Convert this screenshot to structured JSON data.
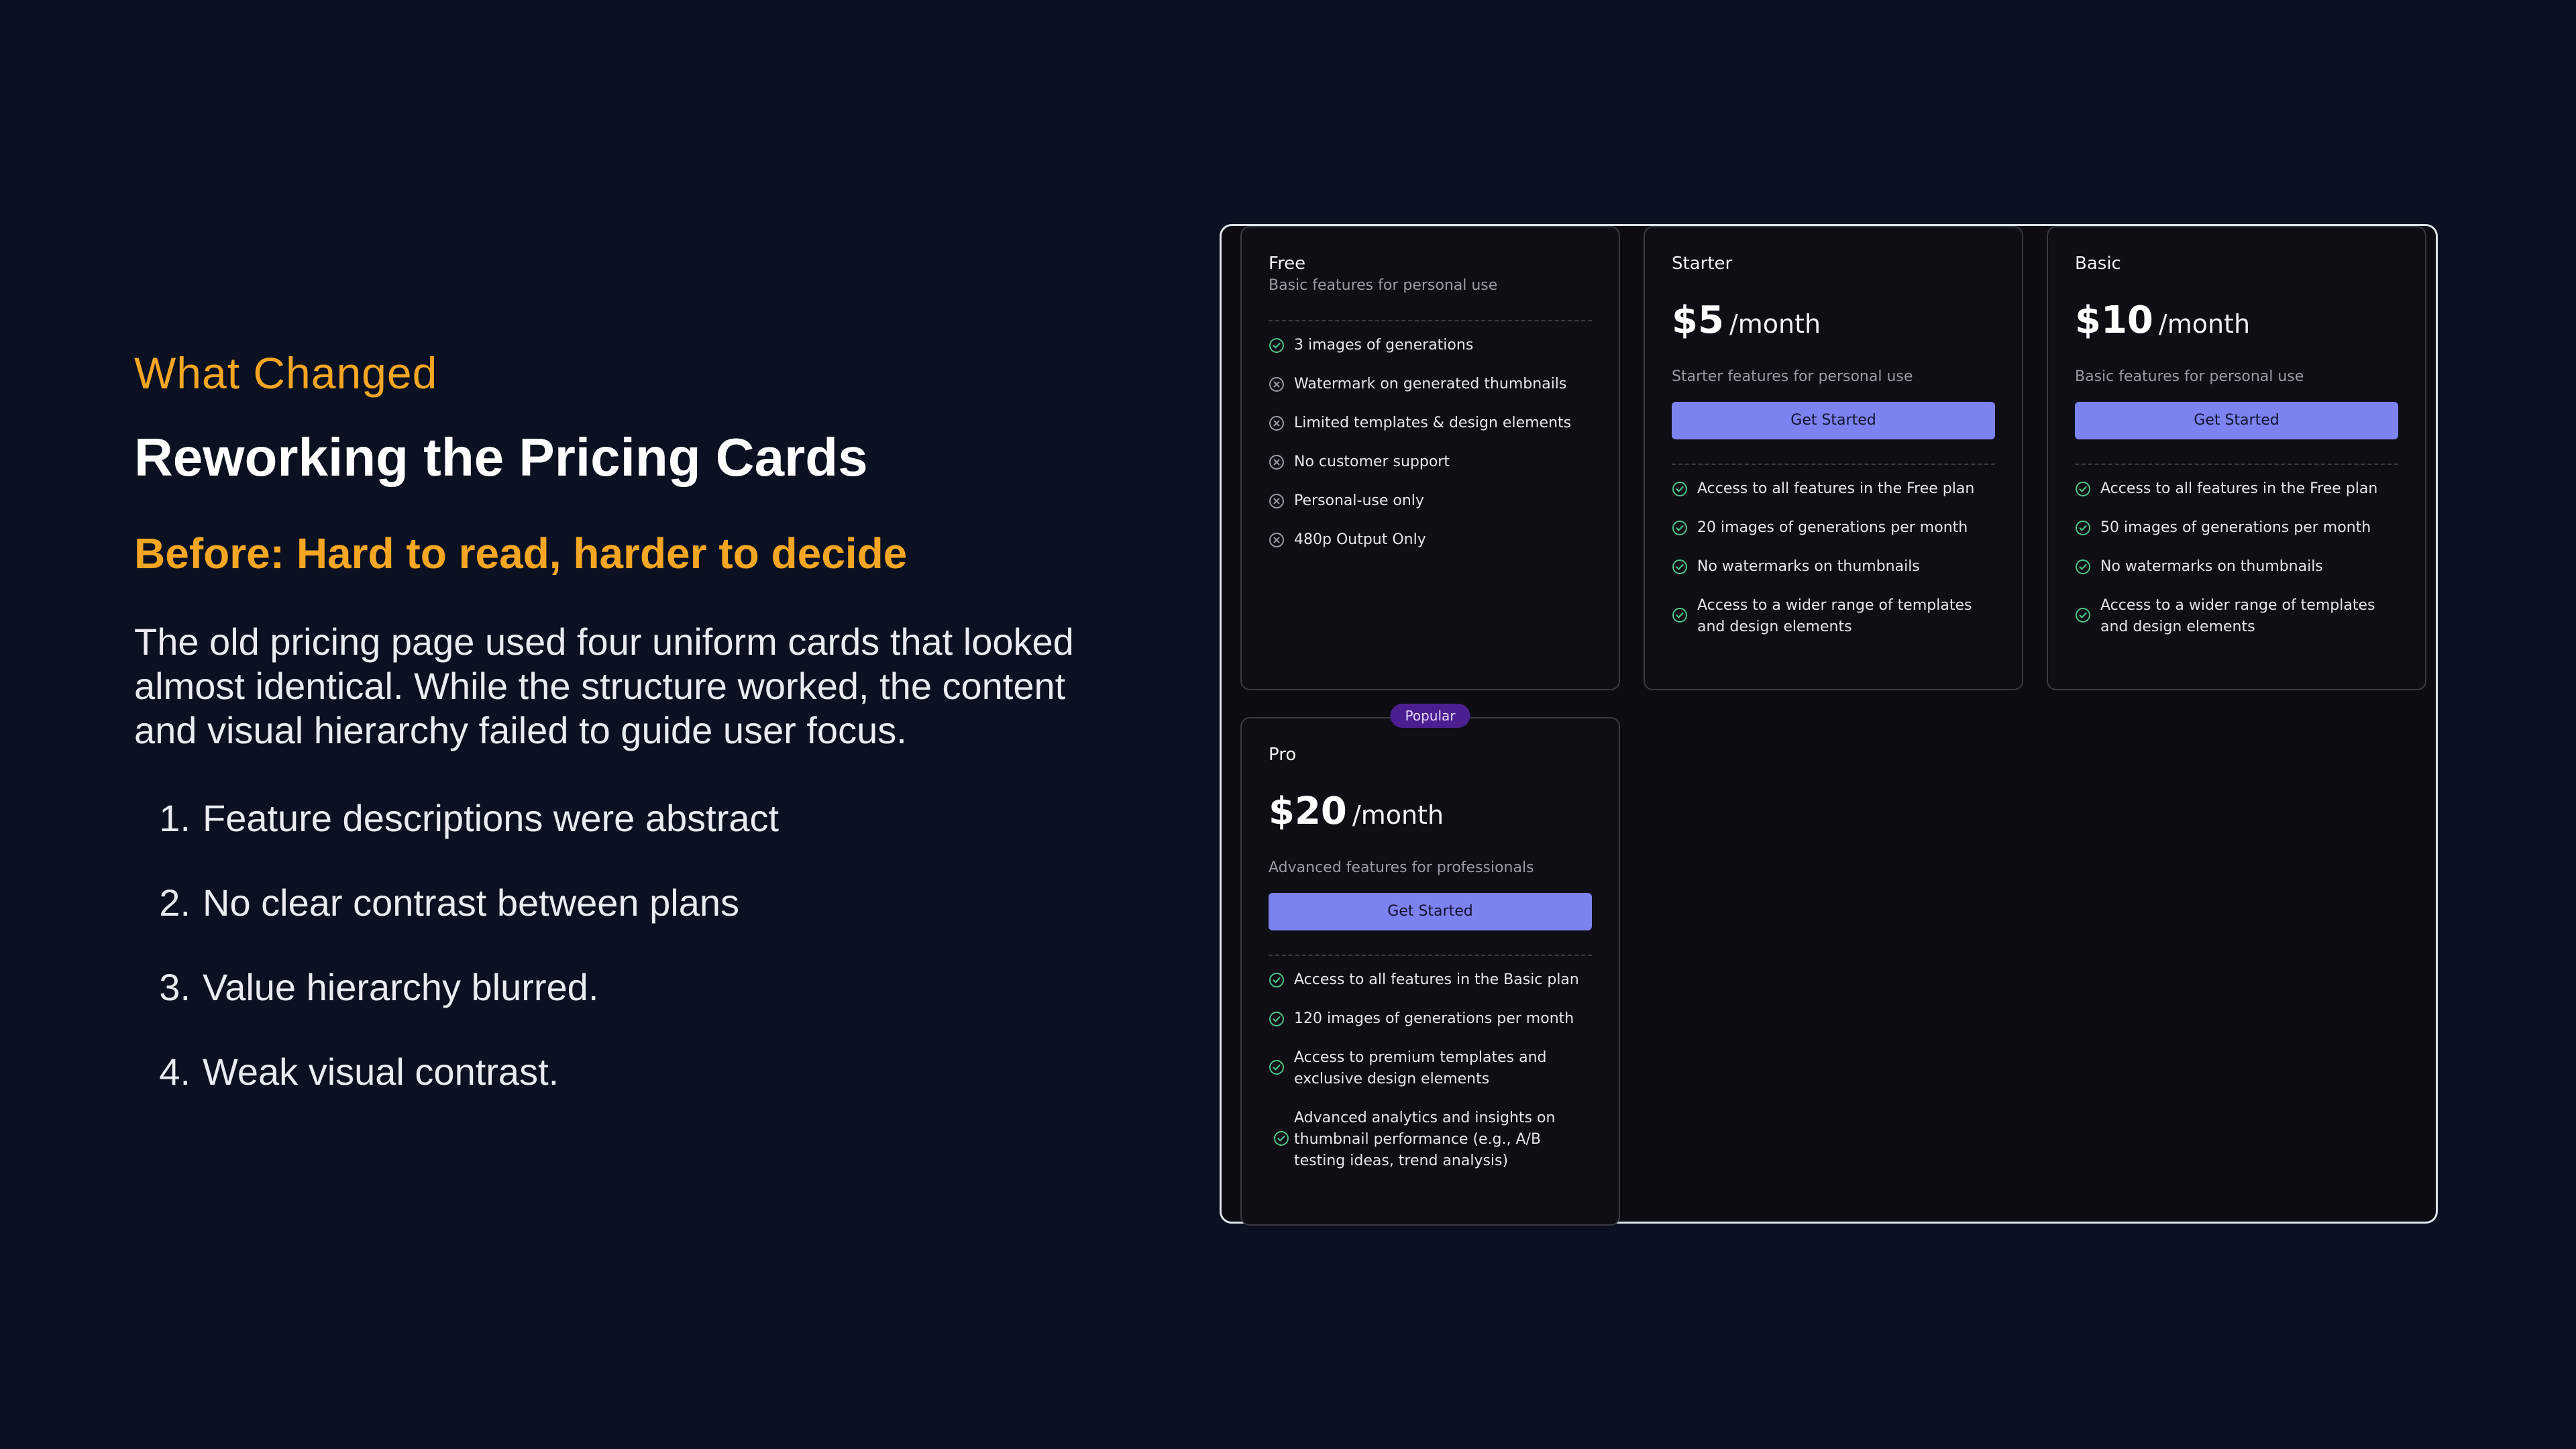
{
  "slide": {
    "eyebrow": "What Changed",
    "title": "Reworking the Pricing Cards",
    "subtitle": "Before: Hard to read, harder to decide",
    "description": "The old pricing page used four uniform cards that looked almost identical. While the structure worked, the content and visual hierarchy failed to guide user focus.",
    "points": [
      {
        "num": "1.",
        "text": "Feature descriptions were abstract"
      },
      {
        "num": "2.",
        "text": "No clear contrast between plans"
      },
      {
        "num": "3.",
        "text": "Value hierarchy blurred."
      },
      {
        "num": "4.",
        "text": "Weak visual contrast."
      }
    ]
  },
  "colors": {
    "background": "#0b1120",
    "accent": "#f5a623",
    "button": "#7c83f0",
    "check": "#4cc38a",
    "cross": "#9a9aa6",
    "badge": "#4b1f8f"
  },
  "plans": {
    "free": {
      "name": "Free",
      "description": "Basic features for personal use",
      "features": [
        {
          "icon": "check-icon",
          "text": "3 images of generations"
        },
        {
          "icon": "x-circle-icon",
          "text": "Watermark on generated thumbnails"
        },
        {
          "icon": "x-circle-icon",
          "text": "Limited templates & design elements"
        },
        {
          "icon": "x-circle-icon",
          "text": "No customer support"
        },
        {
          "icon": "x-circle-icon",
          "text": "Personal-use only"
        },
        {
          "icon": "x-circle-icon",
          "text": "480p Output Only"
        }
      ]
    },
    "starter": {
      "name": "Starter",
      "price": "$5",
      "period": "/month",
      "description": "Starter features for personal use",
      "cta": "Get Started",
      "features": [
        {
          "icon": "check-icon",
          "text": "Access to all features in the Free plan"
        },
        {
          "icon": "check-icon",
          "text": "20 images of generations per month"
        },
        {
          "icon": "check-icon",
          "text": "No watermarks on thumbnails"
        },
        {
          "icon": "check-icon",
          "text": "Access to a wider range of templates and design elements"
        }
      ]
    },
    "basic": {
      "name": "Basic",
      "price": "$10",
      "period": "/month",
      "description": "Basic features for personal use",
      "cta": "Get Started",
      "features": [
        {
          "icon": "check-icon",
          "text": "Access to all features in the Free plan"
        },
        {
          "icon": "check-icon",
          "text": "50 images of generations per month"
        },
        {
          "icon": "check-icon",
          "text": "No watermarks on thumbnails"
        },
        {
          "icon": "check-icon",
          "text": "Access to a wider range of templates and design elements"
        }
      ]
    },
    "pro": {
      "badge": "Popular",
      "name": "Pro",
      "price": "$20",
      "period": "/month",
      "description": "Advanced features for professionals",
      "cta": "Get Started",
      "features": [
        {
          "icon": "check-icon",
          "text": "Access to all features in the Basic plan"
        },
        {
          "icon": "check-icon",
          "text": "120 images of generations per month"
        },
        {
          "icon": "check-icon",
          "text": "Access to premium templates and exclusive design elements"
        },
        {
          "icon": "check-icon",
          "text": "Advanced analytics and insights on thumbnail performance (e.g., A/B testing ideas, trend analysis)"
        }
      ]
    }
  }
}
